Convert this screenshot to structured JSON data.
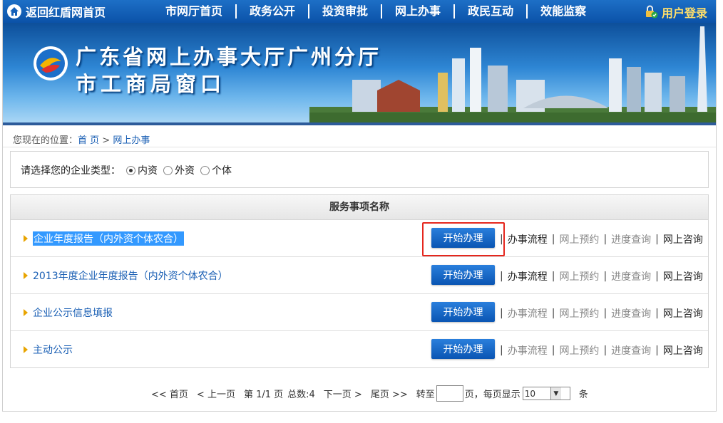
{
  "nav": {
    "home_label": "返回红盾网首页",
    "items": [
      "市网厅首页",
      "政务公开",
      "投资审批",
      "网上办事",
      "政民互动",
      "效能监察"
    ],
    "login_label": "用户登录"
  },
  "banner": {
    "title": "广东省网上办事大厅广州分厅",
    "subtitle": "市工商局窗口"
  },
  "breadcrumb": {
    "prefix": "您现在的位置：",
    "home": "首 页",
    "sep": " > ",
    "current": "网上办事"
  },
  "type_select": {
    "label": "请选择您的企业类型：",
    "options": [
      "内资",
      "外资",
      "个体"
    ],
    "selected": "内资"
  },
  "services": {
    "header": "服务事项名称",
    "start_label": "开始办理",
    "rows": [
      {
        "name": "企业年度报告（内外资个体农合）",
        "actions": [
          "办事流程",
          "网上预约",
          "进度查询",
          "网上咨询"
        ]
      },
      {
        "name": "2013年度企业年度报告（内外资个体农合）",
        "actions": [
          "办事流程",
          "网上预约",
          "进度查询",
          "网上咨询"
        ]
      },
      {
        "name": "企业公示信息填报",
        "actions": [
          "办事流程",
          "网上预约",
          "进度查询",
          "网上咨询"
        ]
      },
      {
        "name": "主动公示",
        "actions": [
          "办事流程",
          "网上预约",
          "进度查询",
          "网上咨询"
        ]
      }
    ]
  },
  "pager": {
    "first": "<< 首页",
    "prev": "< 上一页",
    "page_info": "第 1/1 页",
    "total": "总数:4",
    "next": "下一页 >",
    "last": "尾页 >>",
    "goto_label": "转至",
    "page_unit": "页，每页显示",
    "page_size": "10",
    "size_unit": "条"
  },
  "colors": {
    "nav_bg": "#0b52a8",
    "link": "#1a5fb4",
    "login": "#ffdf6b",
    "button": "#0a55b3",
    "highlight": "#e5261d"
  }
}
